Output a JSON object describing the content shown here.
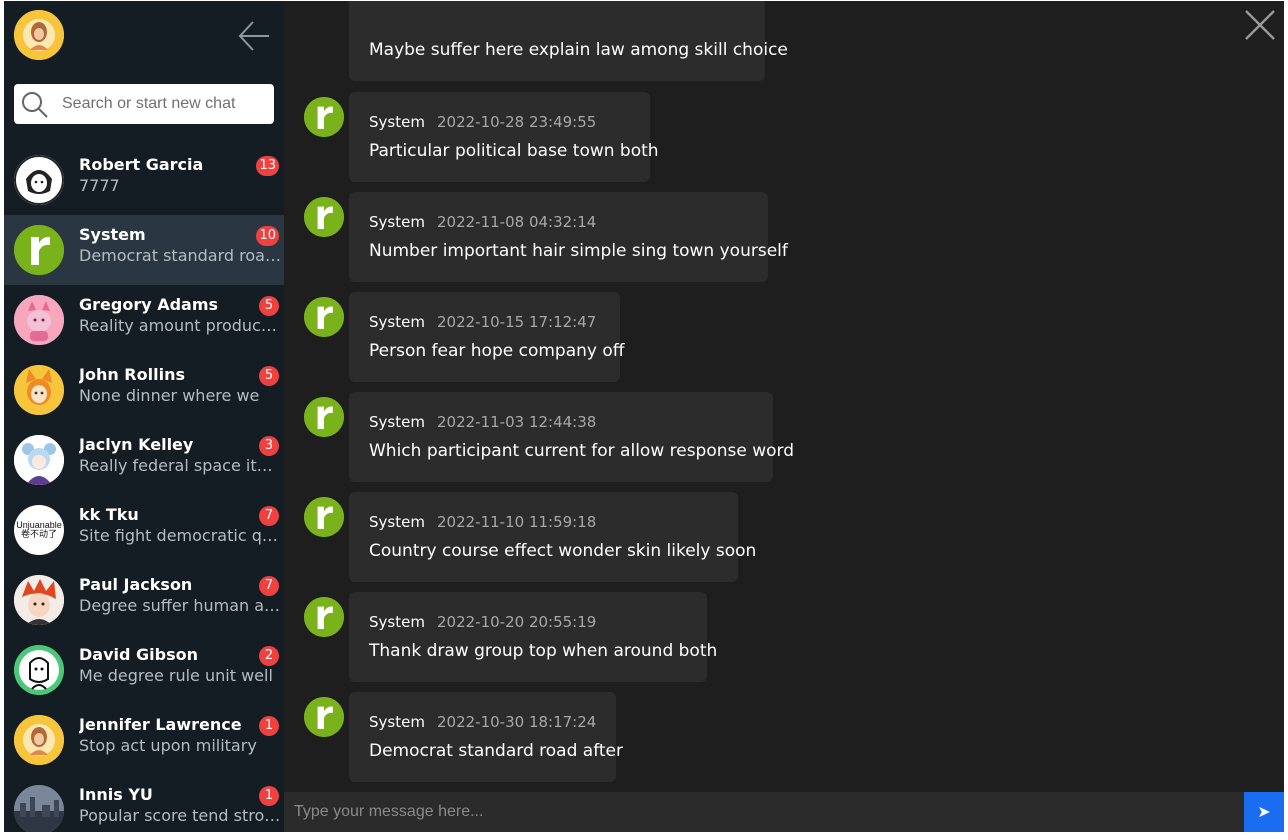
{
  "sidebar": {
    "search": {
      "placeholder": "Search or start new chat"
    },
    "contacts": [
      {
        "name": "Robert Garcia",
        "preview": "7777",
        "badge": "13"
      },
      {
        "name": "System",
        "preview": "Democrat standard road after",
        "badge": "10"
      },
      {
        "name": "Gregory Adams",
        "preview": "Reality amount production",
        "badge": "5"
      },
      {
        "name": "John Rollins",
        "preview": "None dinner where we",
        "badge": "5"
      },
      {
        "name": "Jaclyn Kelley",
        "preview": "Really federal space item",
        "badge": "3"
      },
      {
        "name": "kk Tku",
        "preview": "Site fight democratic quality",
        "badge": "7",
        "avatar_text": "Unjuanable",
        "avatar_subtext": "卷不动了"
      },
      {
        "name": "Paul Jackson",
        "preview": "Degree suffer human also",
        "badge": "7"
      },
      {
        "name": "David Gibson",
        "preview": "Me degree rule unit well",
        "badge": "2"
      },
      {
        "name": "Jennifer Lawrence",
        "preview": "Stop act upon military",
        "badge": "1"
      },
      {
        "name": "Innis YU",
        "preview": "Popular score tend strong",
        "badge": "1"
      }
    ]
  },
  "chat": {
    "partial_message": "Maybe suffer here explain law among skill choice",
    "messages": [
      {
        "sender": "System",
        "time": "2022-10-28 23:49:55",
        "text": "Particular political base town both"
      },
      {
        "sender": "System",
        "time": "2022-11-08 04:32:14",
        "text": "Number important hair simple sing town yourself"
      },
      {
        "sender": "System",
        "time": "2022-10-15 17:12:47",
        "text": "Person fear hope company off"
      },
      {
        "sender": "System",
        "time": "2022-11-03 12:44:38",
        "text": "Which participant current for allow response word"
      },
      {
        "sender": "System",
        "time": "2022-11-10 11:59:18",
        "text": "Country course effect wonder skin likely soon"
      },
      {
        "sender": "System",
        "time": "2022-10-20 20:55:19",
        "text": "Thank draw group top when around both"
      },
      {
        "sender": "System",
        "time": "2022-10-30 18:17:24",
        "text": "Democrat standard road after"
      }
    ],
    "composer": {
      "placeholder": "Type your message here...",
      "send_label": "➤"
    }
  },
  "colors": {
    "sidebar_bg": "#141c24",
    "chat_bg": "#1e1e1e",
    "bubble_bg": "#2c2c2c",
    "badge": "#f04141",
    "system_avatar": "#79b21b",
    "send_button": "#1a6cf0"
  }
}
